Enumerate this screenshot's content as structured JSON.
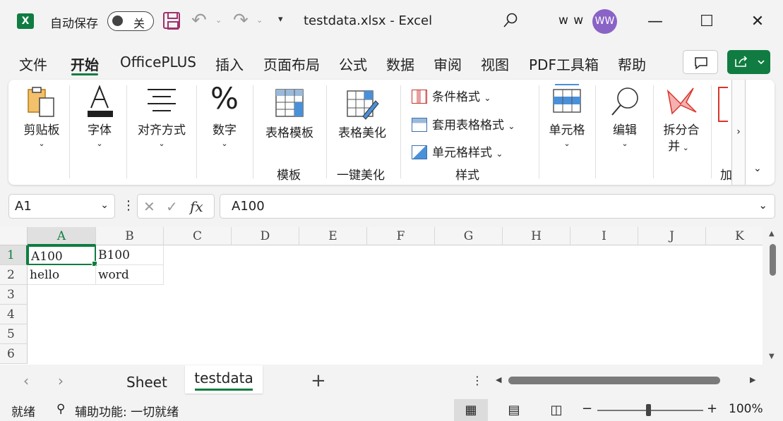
{
  "titlebar": {
    "autosave_label": "自动保存",
    "autosave_state": "关",
    "filename": "testdata.xlsx  -  Excel",
    "user_name": "w w",
    "avatar_initials": "WW"
  },
  "tabs": [
    "文件",
    "开始",
    "OfficePLUS",
    "插入",
    "页面布局",
    "公式",
    "数据",
    "审阅",
    "视图",
    "PDF工具箱",
    "帮助"
  ],
  "active_tab": "开始",
  "ribbon": {
    "clipboard": "剪贴板",
    "font": "字体",
    "align": "对齐方式",
    "number": "数字",
    "table_template": "表格模板",
    "template_group": "模板",
    "beautify": "表格美化",
    "beautify_group": "一键美化",
    "cond_format": "条件格式",
    "table_format": "套用表格格式",
    "cell_style": "单元格样式",
    "style_group": "样式",
    "cells": "单元格",
    "edit": "编辑",
    "split_line1": "拆分合",
    "split_line2": "并",
    "addin_partial": "加"
  },
  "formula_bar": {
    "name_box": "A1",
    "formula": "A100"
  },
  "grid": {
    "columns": [
      "A",
      "B",
      "C",
      "D",
      "E",
      "F",
      "G",
      "H",
      "I",
      "J",
      "K"
    ],
    "rows": [
      "1",
      "2",
      "3",
      "4",
      "5",
      "6"
    ],
    "cells": {
      "A1": "A100",
      "B1": "B100",
      "A2": "hello",
      "B2": "word"
    },
    "active_cell": "A1"
  },
  "sheets": [
    "Sheet",
    "testdata"
  ],
  "active_sheet": "testdata",
  "statusbar": {
    "ready": "就绪",
    "accessibility": "辅助功能: 一切就绪",
    "zoom": "100%"
  },
  "colors": {
    "accent": "#107c41",
    "avatar": "#8a63c6",
    "save_icon": "#a0306d"
  }
}
